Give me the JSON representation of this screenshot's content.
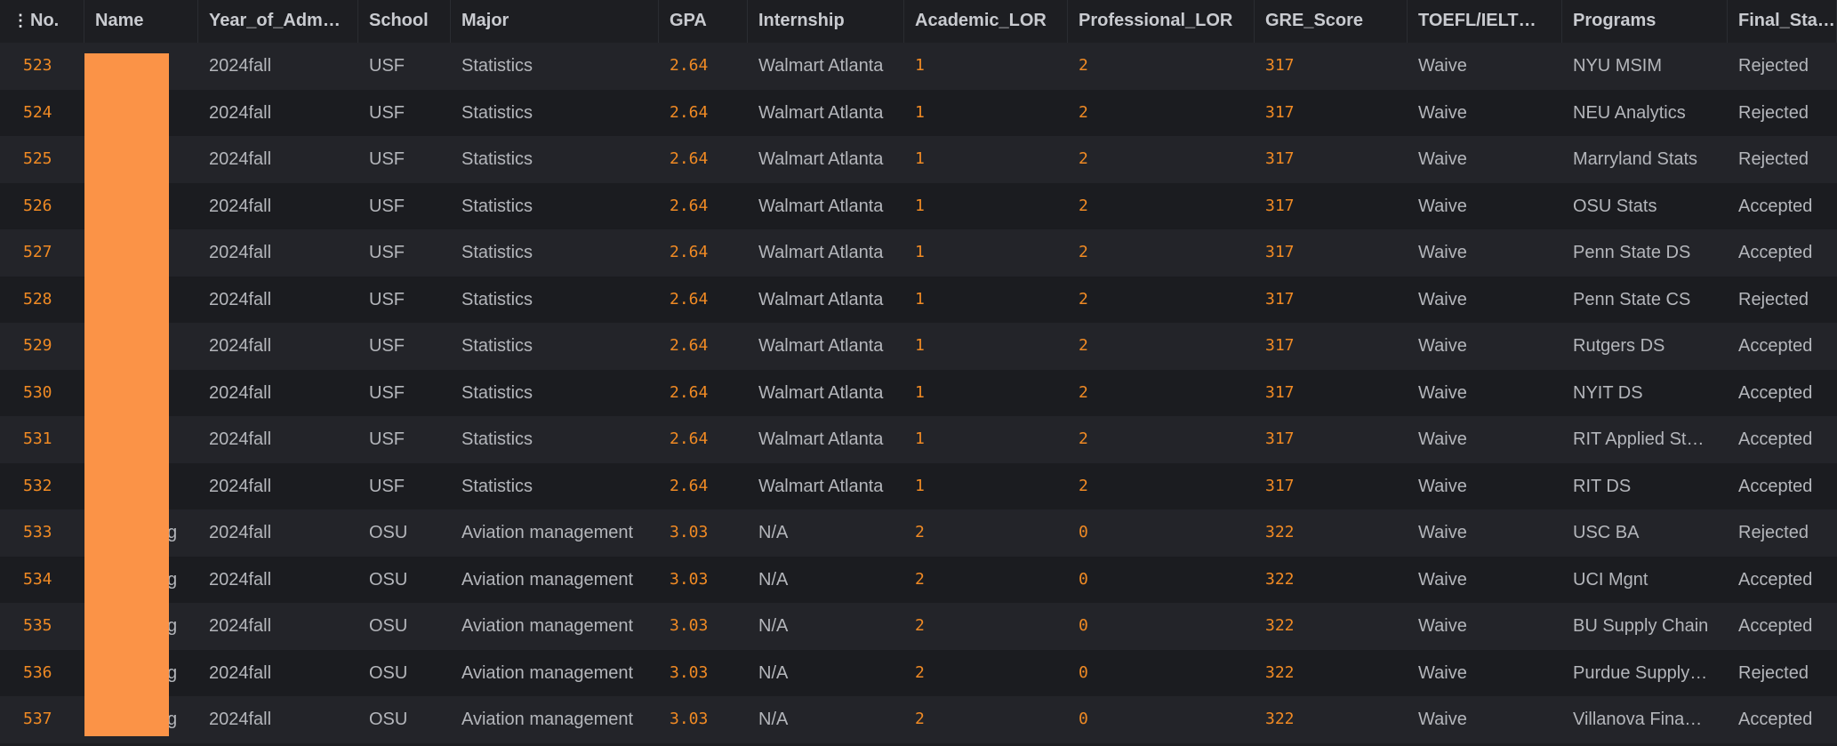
{
  "columns": [
    {
      "key": "no",
      "label": "No.",
      "numeric": true
    },
    {
      "key": "name",
      "label": "Name",
      "numeric": false
    },
    {
      "key": "year",
      "label": "Year_of_Adm…",
      "numeric": false
    },
    {
      "key": "school",
      "label": "School",
      "numeric": false
    },
    {
      "key": "major",
      "label": "Major",
      "numeric": false
    },
    {
      "key": "gpa",
      "label": "GPA",
      "numeric": true
    },
    {
      "key": "internship",
      "label": "Internship",
      "numeric": false
    },
    {
      "key": "academic_lor",
      "label": "Academic_LOR",
      "numeric": true
    },
    {
      "key": "professional_lor",
      "label": "Professional_LOR",
      "numeric": true
    },
    {
      "key": "gre",
      "label": "GRE_Score",
      "numeric": true
    },
    {
      "key": "toefl",
      "label": "TOEFL/IELT…",
      "numeric": false
    },
    {
      "key": "programs",
      "label": "Programs",
      "numeric": false
    },
    {
      "key": "final_status",
      "label": "Final_Status",
      "numeric": false
    }
  ],
  "rows": [
    {
      "no": "523",
      "name": "",
      "year": "2024fall",
      "school": "USF",
      "major": "Statistics",
      "gpa": "2.64",
      "internship": "Walmart Atlanta",
      "academic_lor": "1",
      "professional_lor": "2",
      "gre": "317",
      "toefl": "Waive",
      "programs": "NYU MSIM",
      "final_status": "Rejected"
    },
    {
      "no": "524",
      "name": "",
      "year": "2024fall",
      "school": "USF",
      "major": "Statistics",
      "gpa": "2.64",
      "internship": "Walmart Atlanta",
      "academic_lor": "1",
      "professional_lor": "2",
      "gre": "317",
      "toefl": "Waive",
      "programs": "NEU Analytics",
      "final_status": "Rejected"
    },
    {
      "no": "525",
      "name": "",
      "year": "2024fall",
      "school": "USF",
      "major": "Statistics",
      "gpa": "2.64",
      "internship": "Walmart Atlanta",
      "academic_lor": "1",
      "professional_lor": "2",
      "gre": "317",
      "toefl": "Waive",
      "programs": "Marryland Stats",
      "final_status": "Rejected"
    },
    {
      "no": "526",
      "name": "",
      "year": "2024fall",
      "school": "USF",
      "major": "Statistics",
      "gpa": "2.64",
      "internship": "Walmart Atlanta",
      "academic_lor": "1",
      "professional_lor": "2",
      "gre": "317",
      "toefl": "Waive",
      "programs": "OSU Stats",
      "final_status": "Accepted"
    },
    {
      "no": "527",
      "name": "",
      "year": "2024fall",
      "school": "USF",
      "major": "Statistics",
      "gpa": "2.64",
      "internship": "Walmart Atlanta",
      "academic_lor": "1",
      "professional_lor": "2",
      "gre": "317",
      "toefl": "Waive",
      "programs": "Penn State DS",
      "final_status": "Accepted"
    },
    {
      "no": "528",
      "name": "",
      "year": "2024fall",
      "school": "USF",
      "major": "Statistics",
      "gpa": "2.64",
      "internship": "Walmart Atlanta",
      "academic_lor": "1",
      "professional_lor": "2",
      "gre": "317",
      "toefl": "Waive",
      "programs": "Penn State CS",
      "final_status": "Rejected"
    },
    {
      "no": "529",
      "name": "",
      "year": "2024fall",
      "school": "USF",
      "major": "Statistics",
      "gpa": "2.64",
      "internship": "Walmart Atlanta",
      "academic_lor": "1",
      "professional_lor": "2",
      "gre": "317",
      "toefl": "Waive",
      "programs": "Rutgers DS",
      "final_status": "Accepted"
    },
    {
      "no": "530",
      "name": "",
      "year": "2024fall",
      "school": "USF",
      "major": "Statistics",
      "gpa": "2.64",
      "internship": "Walmart Atlanta",
      "academic_lor": "1",
      "professional_lor": "2",
      "gre": "317",
      "toefl": "Waive",
      "programs": "NYIT DS",
      "final_status": "Accepted"
    },
    {
      "no": "531",
      "name": "",
      "year": "2024fall",
      "school": "USF",
      "major": "Statistics",
      "gpa": "2.64",
      "internship": "Walmart Atlanta",
      "academic_lor": "1",
      "professional_lor": "2",
      "gre": "317",
      "toefl": "Waive",
      "programs": "RIT Applied St…",
      "final_status": "Accepted"
    },
    {
      "no": "532",
      "name": "",
      "year": "2024fall",
      "school": "USF",
      "major": "Statistics",
      "gpa": "2.64",
      "internship": "Walmart Atlanta",
      "academic_lor": "1",
      "professional_lor": "2",
      "gre": "317",
      "toefl": "Waive",
      "programs": "RIT DS",
      "final_status": "Accepted"
    },
    {
      "no": "533",
      "name": "g",
      "year": "2024fall",
      "school": "OSU",
      "major": "Aviation management",
      "gpa": "3.03",
      "internship": "N/A",
      "academic_lor": "2",
      "professional_lor": "0",
      "gre": "322",
      "toefl": "Waive",
      "programs": "USC BA",
      "final_status": "Rejected"
    },
    {
      "no": "534",
      "name": "g",
      "year": "2024fall",
      "school": "OSU",
      "major": "Aviation management",
      "gpa": "3.03",
      "internship": "N/A",
      "academic_lor": "2",
      "professional_lor": "0",
      "gre": "322",
      "toefl": "Waive",
      "programs": "UCI Mgnt",
      "final_status": "Accepted"
    },
    {
      "no": "535",
      "name": "g",
      "year": "2024fall",
      "school": "OSU",
      "major": "Aviation management",
      "gpa": "3.03",
      "internship": "N/A",
      "academic_lor": "2",
      "professional_lor": "0",
      "gre": "322",
      "toefl": "Waive",
      "programs": "BU Supply Chain",
      "final_status": "Accepted"
    },
    {
      "no": "536",
      "name": "g",
      "year": "2024fall",
      "school": "OSU",
      "major": "Aviation management",
      "gpa": "3.03",
      "internship": "N/A",
      "academic_lor": "2",
      "professional_lor": "0",
      "gre": "322",
      "toefl": "Waive",
      "programs": "Purdue Supply…",
      "final_status": "Rejected"
    },
    {
      "no": "537",
      "name": "g",
      "year": "2024fall",
      "school": "OSU",
      "major": "Aviation management",
      "gpa": "3.03",
      "internship": "N/A",
      "academic_lor": "2",
      "professional_lor": "0",
      "gre": "322",
      "toefl": "Waive",
      "programs": "Villanova Fina…",
      "final_status": "Accepted"
    }
  ],
  "colors": {
    "numeric": "#f08a24",
    "redaction": "#fb9347",
    "text": "#b4b6bb",
    "header_bg": "#1d1e22"
  },
  "icons": {
    "column_menu": "vertical-ellipsis-icon"
  }
}
